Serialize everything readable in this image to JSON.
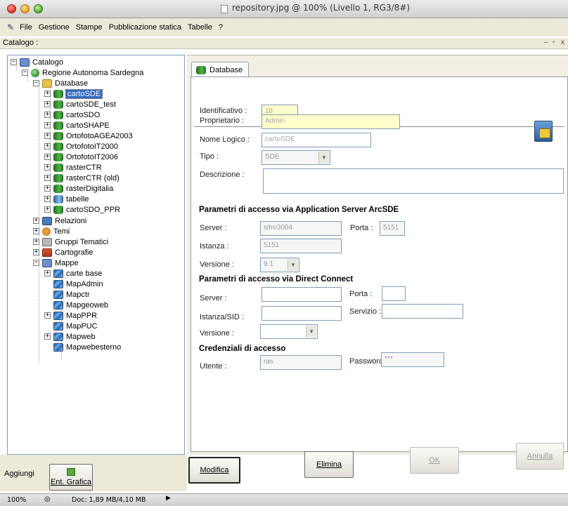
{
  "window": {
    "title": "repository.jpg @ 100% (Livello 1, RG3/8#)"
  },
  "menu": {
    "items": [
      "File",
      "Gestione",
      "Stampe",
      "Pubblicazione statica",
      "Tabelle",
      "?"
    ]
  },
  "catalog_label": "Catalogo :",
  "window_controls": "_ ̅□ x",
  "tree": {
    "root": "Catalogo",
    "region": "Regione Autonoma Sardegna",
    "database": "Database",
    "databases": [
      "cartoSDE",
      "cartoSDE_test",
      "cartoSDO",
      "cartoSHAPE",
      "OrtofotoAGEA2003",
      "OrtofotoIT2000",
      "OrtofotoIT2006",
      "rasterCTR",
      "rasterCTR (old)",
      "rasterDigitalia",
      "tabelle",
      "cartoSDO_PPR"
    ],
    "relazioni": "Relazioni",
    "temi": "Temi",
    "gruppi": "Gruppi Tematici",
    "cartografie": "Cartografie",
    "mappe": "Mappe",
    "maps": [
      "carte base",
      "MapAdmin",
      "Mapctr",
      "Mapgeoweb",
      "MapPPR",
      "MapPUC",
      "Mapweb",
      "Mapwebesterno"
    ]
  },
  "tab": {
    "label": "Database"
  },
  "form": {
    "identificativo_label": "Identificativo :",
    "identificativo_value": "18",
    "proprietario_label": "Proprietario :",
    "proprietario_value": "Admin",
    "nome_logico_label": "Nome Logico :",
    "nome_logico_value": "cartoSDE",
    "tipo_label": "Tipo :",
    "tipo_value": "SDE",
    "descrizione_label": "Descrizione :",
    "descrizione_value": "",
    "section_arcsde": "Parametri di accesso via Application Server ArcSDE",
    "server_label": "Server :",
    "server_value": "sitro3004",
    "porta_label": "Porta :",
    "porta_value": "5151",
    "istanza_label": "Istanza :",
    "istanza_value": "5151",
    "versione_label": "Versione :",
    "versione_value": "9.1",
    "section_direct": "Parametri di accesso via Direct Connect",
    "dc_server_label": "Server :",
    "dc_server_value": "",
    "dc_porta_label": "Porta :",
    "dc_porta_value": "",
    "dc_istanza_label": "Istanza/SID :",
    "dc_istanza_value": "",
    "dc_servizio_label": "Servizio :",
    "dc_servizio_value": "",
    "dc_versione_label": "Versione :",
    "dc_versione_value": "",
    "section_cred": "Credenziali di accesso",
    "utente_label": "Utente :",
    "utente_value": "ras",
    "password_label": "Password :",
    "password_value": "***"
  },
  "buttons": {
    "modifica": "Modifica",
    "elimina": "Elimina",
    "ok": "OK",
    "annulla": "Annulla"
  },
  "aggiungi": {
    "label": "Aggiungi",
    "button": "Ent. Grafica"
  },
  "status": {
    "zoom": "100%",
    "doc": "Doc: 1,89 MB/4,10 MB"
  }
}
